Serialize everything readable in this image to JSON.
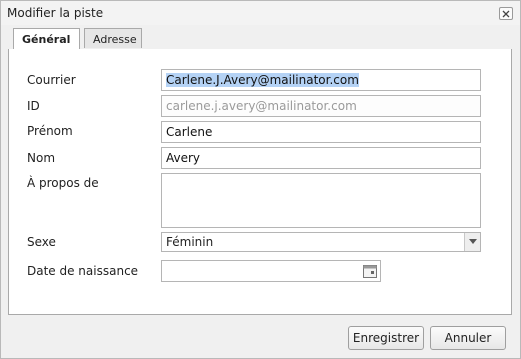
{
  "dialog": {
    "title": "Modifier la piste",
    "tabs": [
      {
        "label": "Général",
        "active": true
      },
      {
        "label": "Adresse",
        "active": false
      }
    ],
    "fields": {
      "courrier": {
        "label": "Courrier",
        "value": "Carlene.J.Avery@mailinator.com"
      },
      "id": {
        "label": "ID",
        "value": "carlene.j.avery@mailinator.com"
      },
      "prenom": {
        "label": "Prénom",
        "value": "Carlene"
      },
      "nom": {
        "label": "Nom",
        "value": "Avery"
      },
      "apropos": {
        "label": "À propos de",
        "value": ""
      },
      "sexe": {
        "label": "Sexe",
        "value": "Féminin"
      },
      "naissance": {
        "label": "Date de naissance",
        "value": ""
      }
    },
    "buttons": {
      "save": "Enregistrer",
      "cancel": "Annuler"
    }
  },
  "icons": {
    "close": "close-icon",
    "dropdown": "chevron-down-icon",
    "calendar": "calendar-icon"
  },
  "colors": {
    "selection": "#b4d2f5",
    "border": "#b5b5b5"
  }
}
